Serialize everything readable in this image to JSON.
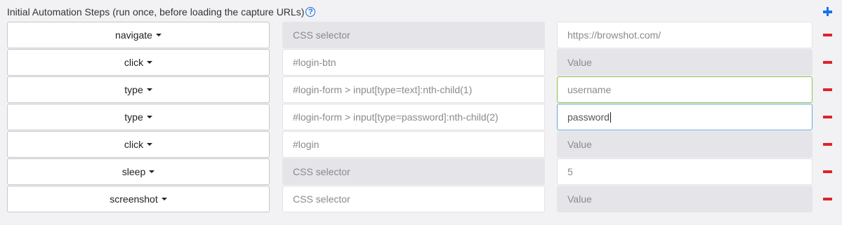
{
  "header": {
    "title": "Initial Automation Steps (run once, before loading the capture URLs)",
    "help_glyph": "?"
  },
  "colors": {
    "accent": "#1a73e8",
    "remove": "#e0222a",
    "valid_border": "#8bc34a"
  },
  "steps": [
    {
      "action": "navigate",
      "selector": "CSS selector",
      "selector_enabled": false,
      "value": "https://browshot.com/",
      "value_enabled": true
    },
    {
      "action": "click",
      "selector": "#login-btn",
      "selector_enabled": true,
      "value": "Value",
      "value_enabled": false
    },
    {
      "action": "type",
      "selector": "#login-form > input[type=text]:nth-child(1)",
      "selector_enabled": true,
      "value": "username",
      "value_enabled": true
    },
    {
      "action": "type",
      "selector": "#login-form > input[type=password]:nth-child(2)",
      "selector_enabled": true,
      "value": "password",
      "value_enabled": true
    },
    {
      "action": "click",
      "selector": "#login",
      "selector_enabled": true,
      "value": "Value",
      "value_enabled": false
    },
    {
      "action": "sleep",
      "selector": "CSS selector",
      "selector_enabled": false,
      "value": "5",
      "value_enabled": true
    },
    {
      "action": "screenshot",
      "selector": "CSS selector",
      "selector_enabled": true,
      "value": "Value",
      "value_enabled": false
    }
  ]
}
